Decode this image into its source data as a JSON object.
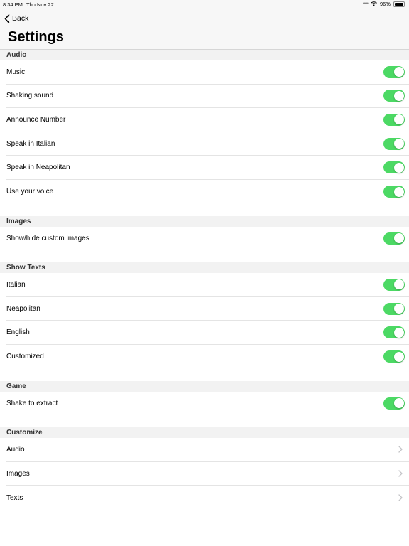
{
  "status": {
    "time": "8:34 PM",
    "date": "Thu Nov 22",
    "battery": "96%",
    "battery_level": 0.96
  },
  "nav": {
    "back_label": "Back",
    "title": "Settings"
  },
  "sections": {
    "audio": {
      "header": "Audio",
      "items": [
        {
          "label": "Music",
          "on": true
        },
        {
          "label": "Shaking sound",
          "on": true
        },
        {
          "label": "Announce Number",
          "on": true
        },
        {
          "label": "Speak in Italian",
          "on": true
        },
        {
          "label": "Speak in Neapolitan",
          "on": true
        },
        {
          "label": "Use your voice",
          "on": true
        }
      ]
    },
    "images": {
      "header": "Images",
      "items": [
        {
          "label": "Show/hide custom images",
          "on": true
        }
      ]
    },
    "show_texts": {
      "header": "Show Texts",
      "items": [
        {
          "label": "Italian",
          "on": true
        },
        {
          "label": "Neapolitan",
          "on": true
        },
        {
          "label": "English",
          "on": true
        },
        {
          "label": "Customized",
          "on": true
        }
      ]
    },
    "game": {
      "header": "Game",
      "items": [
        {
          "label": "Shake to extract",
          "on": true
        }
      ]
    },
    "customize": {
      "header": "Customize",
      "items": [
        {
          "label": "Audio"
        },
        {
          "label": "Images"
        },
        {
          "label": "Texts"
        }
      ]
    }
  },
  "colors": {
    "toggle_on": "#4cd964",
    "section_bg": "#f2f2f2"
  }
}
